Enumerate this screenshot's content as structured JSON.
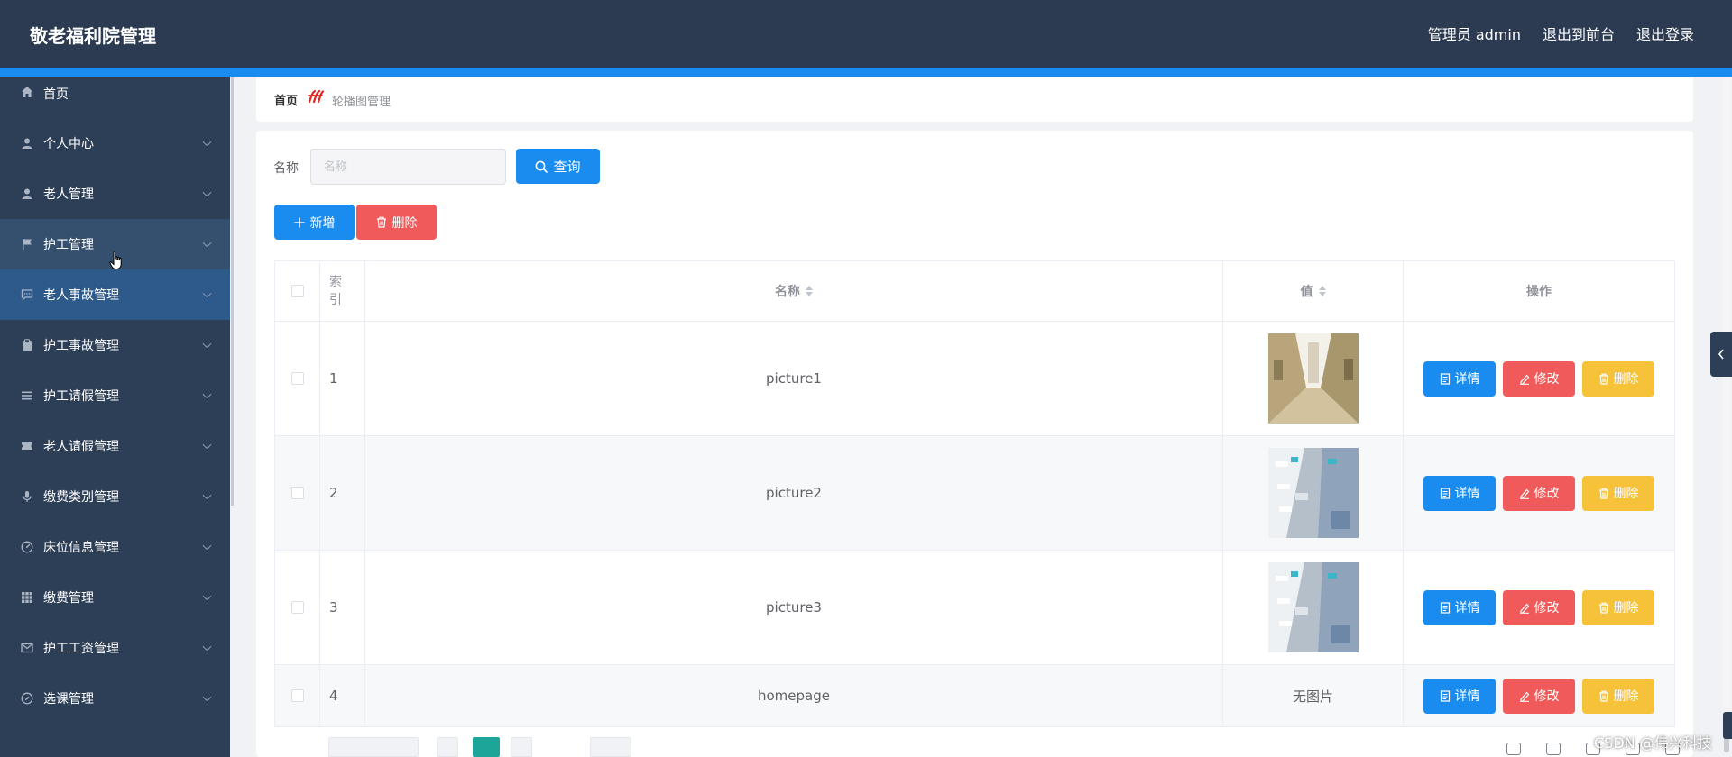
{
  "header": {
    "title": "敬老福利院管理",
    "admin": "管理员 admin",
    "to_front": "退出到前台",
    "logout": "退出登录"
  },
  "sidebar": {
    "items": [
      {
        "label": "首页",
        "icon": "home-icon"
      },
      {
        "label": "个人中心",
        "icon": "user-icon"
      },
      {
        "label": "老人管理",
        "icon": "user-icon"
      },
      {
        "label": "护工管理",
        "icon": "flag-icon"
      },
      {
        "label": "老人事故管理",
        "icon": "chat-icon"
      },
      {
        "label": "护工事故管理",
        "icon": "clipboard-icon"
      },
      {
        "label": "护工请假管理",
        "icon": "menu-icon"
      },
      {
        "label": "老人请假管理",
        "icon": "ticket-icon"
      },
      {
        "label": "缴费类别管理",
        "icon": "microphone-icon"
      },
      {
        "label": "床位信息管理",
        "icon": "gauge-icon"
      },
      {
        "label": "缴费管理",
        "icon": "grid-icon"
      },
      {
        "label": "护工工资管理",
        "icon": "mail-icon"
      },
      {
        "label": "选课管理",
        "icon": "compass-icon"
      }
    ],
    "hover_index": 3,
    "active_index": 4
  },
  "breadcrumb": {
    "home": "首页",
    "current": "轮播图管理"
  },
  "search": {
    "label": "名称",
    "placeholder": "名称",
    "query_button": "查询"
  },
  "actions": {
    "add": "新增",
    "delete": "删除"
  },
  "table": {
    "columns": [
      "索引",
      "名称",
      "值",
      "操作"
    ],
    "rows": [
      {
        "index": "1",
        "name": "picture1",
        "value": "",
        "image": "corridor"
      },
      {
        "index": "2",
        "name": "picture2",
        "value": "",
        "image": "building"
      },
      {
        "index": "3",
        "name": "picture3",
        "value": "",
        "image": "building"
      },
      {
        "index": "4",
        "name": "homepage",
        "value": "无图片",
        "image": ""
      }
    ],
    "ops": {
      "detail": "详情",
      "edit": "修改",
      "remove": "删除"
    }
  },
  "watermark": "CSDN @伟兴科技",
  "colors": {
    "header_bg": "#2c3b52",
    "accent": "#1a8cf0",
    "sidebar_bg": "#2d3f57",
    "primary": "#1a8cf0",
    "danger": "#f05a5a",
    "warning": "#f5c23a",
    "pager_active": "#1ea59a"
  }
}
